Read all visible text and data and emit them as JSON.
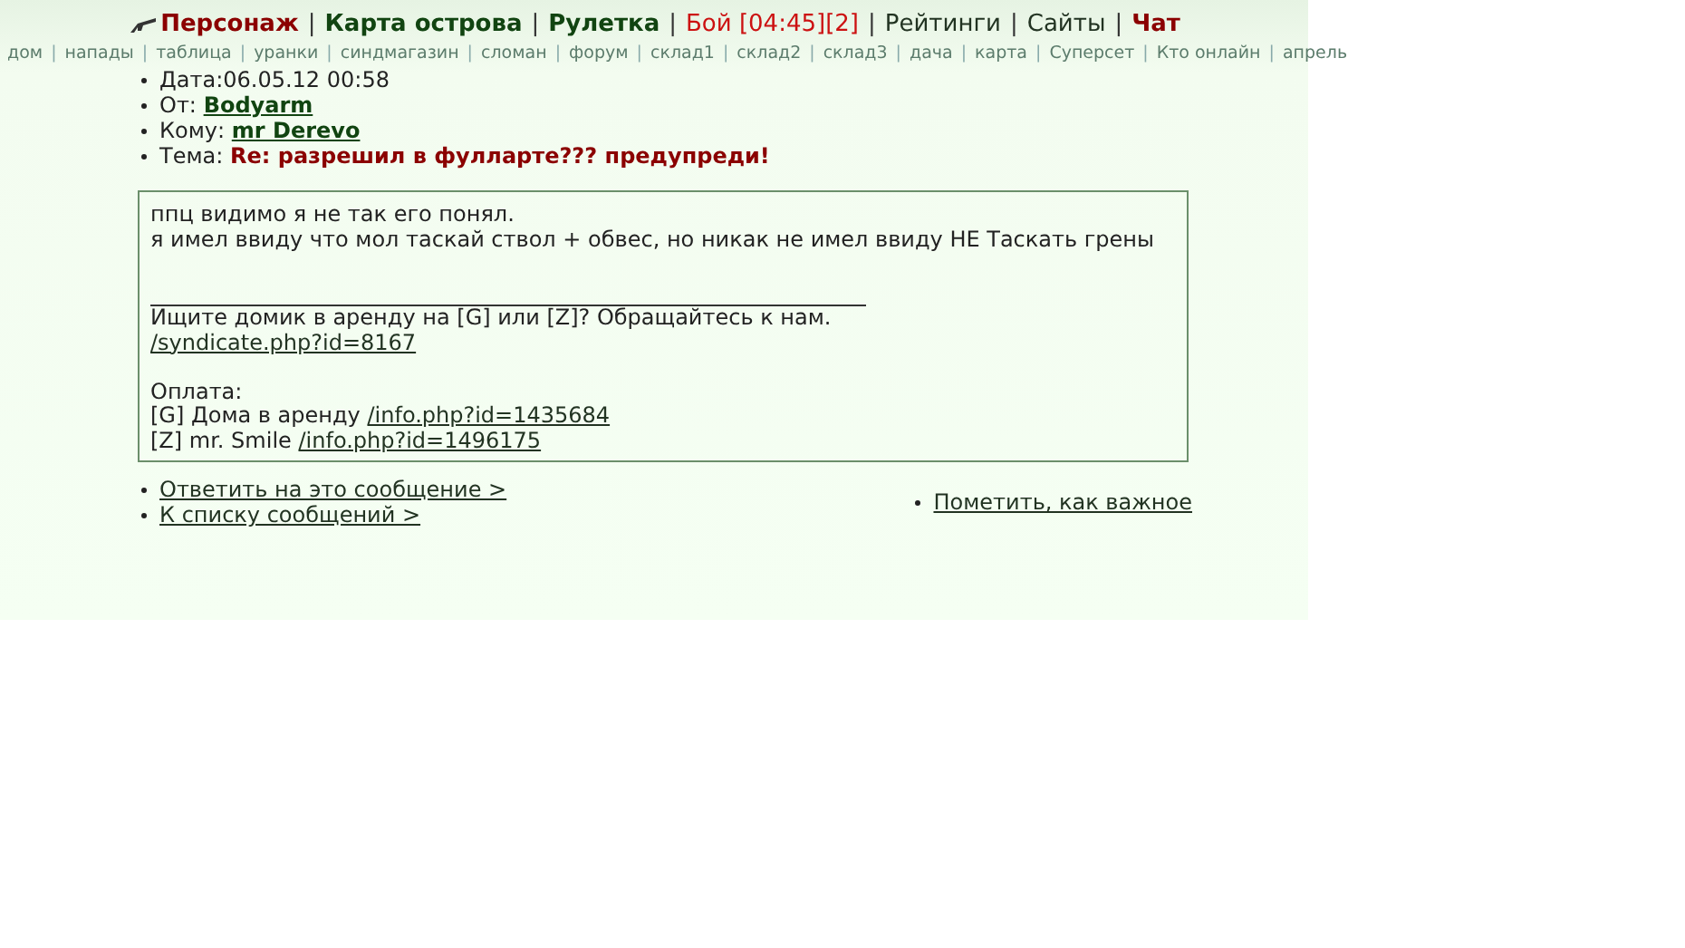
{
  "top_nav": {
    "separator": "|",
    "items": [
      {
        "label": "Персонаж",
        "kind": "accent"
      },
      {
        "label": "Карта острова",
        "kind": "strong"
      },
      {
        "label": "Рулетка",
        "kind": "strong"
      },
      {
        "label": "Бой [04:45][2]",
        "kind": "alert"
      },
      {
        "label": "Рейтинги",
        "kind": "plain"
      },
      {
        "label": "Сайты",
        "kind": "plain"
      },
      {
        "label": "Чат",
        "kind": "accent"
      }
    ]
  },
  "sub_nav": {
    "separator": "|",
    "items": [
      "дом",
      "напады",
      "таблица",
      "уранки",
      "синдмагазин",
      "сломан",
      "форум",
      "склад1",
      "склад2",
      "склад3",
      "дача",
      "карта",
      "Суперсет",
      "Кто онлайн",
      "апрель"
    ]
  },
  "header": [
    {
      "label": "Дата:",
      "value": "06.05.12 00:58",
      "kind": "text"
    },
    {
      "label": "От:",
      "value": "Bodyarm",
      "kind": "user"
    },
    {
      "label": "Кому:",
      "value": "mr Derevo",
      "kind": "user"
    },
    {
      "label": "Тема:",
      "value": "Re: разрешил в фулларте??? предупреди!",
      "kind": "subject"
    }
  ],
  "message": {
    "lines": [
      {
        "kind": "text",
        "text": "ппц видимо я не так его понял."
      },
      {
        "kind": "text",
        "text": "я имел ввиду что мол таскай ствол + обвес, но никак не имел ввиду НЕ Таскать грены"
      },
      {
        "kind": "blank"
      },
      {
        "kind": "blank"
      },
      {
        "kind": "rule"
      },
      {
        "kind": "text",
        "text": "Ищите домик в аренду на [G] или [Z]? Обращайтесь к нам."
      },
      {
        "kind": "link",
        "link": "/syndicate.php?id=8167"
      },
      {
        "kind": "blank"
      },
      {
        "kind": "text",
        "text": "Оплата:"
      },
      {
        "kind": "mixed",
        "text": "[G] Дома в аренду",
        "link": "/info.php?id=1435684"
      },
      {
        "kind": "mixed",
        "text": "[Z] mr. Smile",
        "link": "/info.php?id=1496175"
      }
    ]
  },
  "actions_left": [
    "Ответить на это сообщение >",
    "К списку сообщений >"
  ],
  "actions_right": [
    "Пометить, как важное"
  ]
}
